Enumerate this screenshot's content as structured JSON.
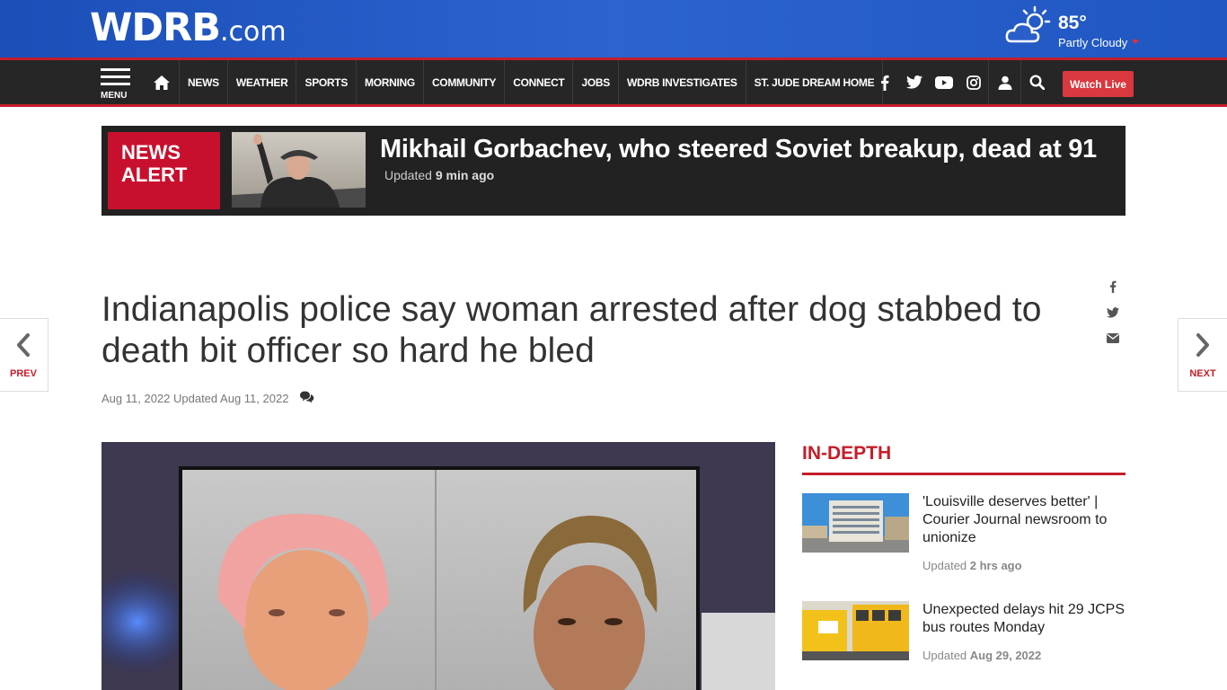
{
  "site": {
    "logo_main": "WDRB",
    "logo_suffix": ".com"
  },
  "weather": {
    "temp": "85°",
    "condition": "Partly Cloudy",
    "icon": "partly-cloudy-icon"
  },
  "nav": {
    "menu_label": "MENU",
    "links": [
      "NEWS",
      "WEATHER",
      "SPORTS",
      "MORNING",
      "COMMUNITY",
      "CONNECT",
      "JOBS",
      "WDRB INVESTIGATES",
      "ST. JUDE DREAM HOME"
    ],
    "watch_live": "Watch Live",
    "social_icons": [
      "facebook-icon",
      "twitter-icon",
      "youtube-icon",
      "instagram-icon"
    ]
  },
  "alert": {
    "tag_line1": "NEWS",
    "tag_line2": "ALERT",
    "headline": "Mikhail Gorbachev, who steered Soviet breakup, dead at 91",
    "updated_prefix": "Updated ",
    "updated_time": "9 min ago"
  },
  "article": {
    "title": "Indianapolis police say woman arrested after dog stabbed to death bit officer so hard he bled",
    "date_line": "Aug 11, 2022 Updated Aug 11, 2022"
  },
  "pager": {
    "prev": "PREV",
    "next": "NEXT"
  },
  "indepth": {
    "heading": "IN-DEPTH",
    "stories": [
      {
        "headline": "'Louisville deserves better' | Courier Journal newsroom to unionize",
        "updated_prefix": "Updated ",
        "updated_time": "2 hrs ago"
      },
      {
        "headline": "Unexpected delays hit 29 JCPS bus routes Monday",
        "updated_prefix": "Updated ",
        "updated_time": "Aug 29, 2022"
      }
    ]
  },
  "colors": {
    "brand_blue": "#1f56c2",
    "accent_red": "#c41e2a",
    "nav_bg": "#262626"
  }
}
